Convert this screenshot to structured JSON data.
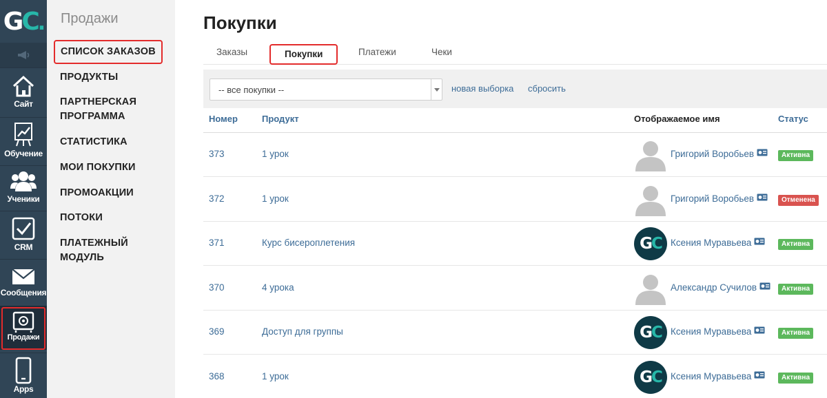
{
  "brand": {
    "logo_text": "GC"
  },
  "colors": {
    "sidebar": "#304556",
    "link": "#3d6c97",
    "accent": "#27b7a9",
    "highlight": "#e32b2b",
    "status_active": "#5cb85c",
    "status_cancelled": "#d9534f"
  },
  "rail": {
    "items": [
      {
        "label": "Сайт",
        "icon": "home-icon"
      },
      {
        "label": "Обучение",
        "icon": "chart-board-icon"
      },
      {
        "label": "Ученики",
        "icon": "users-icon"
      },
      {
        "label": "CRM",
        "icon": "checkbox-icon"
      },
      {
        "label": "Сообщения",
        "icon": "envelope-icon"
      },
      {
        "label": "Продажи",
        "icon": "safe-icon"
      },
      {
        "label": "Apps",
        "icon": "phone-icon"
      }
    ]
  },
  "submenu": {
    "title": "Продажи",
    "items": [
      {
        "label": "СПИСОК ЗАКАЗОВ"
      },
      {
        "label": "ПРОДУКТЫ"
      },
      {
        "label": "ПАРТНЕРСКАЯ ПРОГРАММА"
      },
      {
        "label": "СТАТИСТИКА"
      },
      {
        "label": "МОИ ПОКУПКИ"
      },
      {
        "label": "ПРОМОАКЦИИ"
      },
      {
        "label": "ПОТОКИ"
      },
      {
        "label": "ПЛАТЕЖНЫЙ МОДУЛЬ"
      }
    ]
  },
  "page": {
    "title": "Покупки"
  },
  "tabs": [
    {
      "label": "Заказы"
    },
    {
      "label": "Покупки"
    },
    {
      "label": "Платежи"
    },
    {
      "label": "Чеки"
    }
  ],
  "filter": {
    "selected": "-- все покупки --",
    "new_selection": "новая выборка",
    "reset": "сбросить"
  },
  "table": {
    "columns": [
      "Номер",
      "Продукт",
      "Отображаемое имя",
      "Статус"
    ],
    "rows": [
      {
        "number": "373",
        "product": "1 урок",
        "name": "Григорий Воробьев",
        "avatar": "default",
        "status": "Активна",
        "status_type": "active"
      },
      {
        "number": "372",
        "product": "1 урок",
        "name": "Григорий Воробьев",
        "avatar": "default",
        "status": "Отменена",
        "status_type": "cancelled"
      },
      {
        "number": "371",
        "product": "Курс бисероплетения",
        "name": "Ксения Муравьева",
        "avatar": "gc",
        "status": "Активна",
        "status_type": "active"
      },
      {
        "number": "370",
        "product": "4 урока",
        "name": "Александр Сучилов",
        "avatar": "default",
        "status": "Активна",
        "status_type": "active"
      },
      {
        "number": "369",
        "product": "Доступ для группы",
        "name": "Ксения Муравьева",
        "avatar": "gc",
        "status": "Активна",
        "status_type": "active"
      },
      {
        "number": "368",
        "product": "1 урок",
        "name": "Ксения Муравьева",
        "avatar": "gc",
        "status": "Активна",
        "status_type": "active"
      }
    ]
  }
}
